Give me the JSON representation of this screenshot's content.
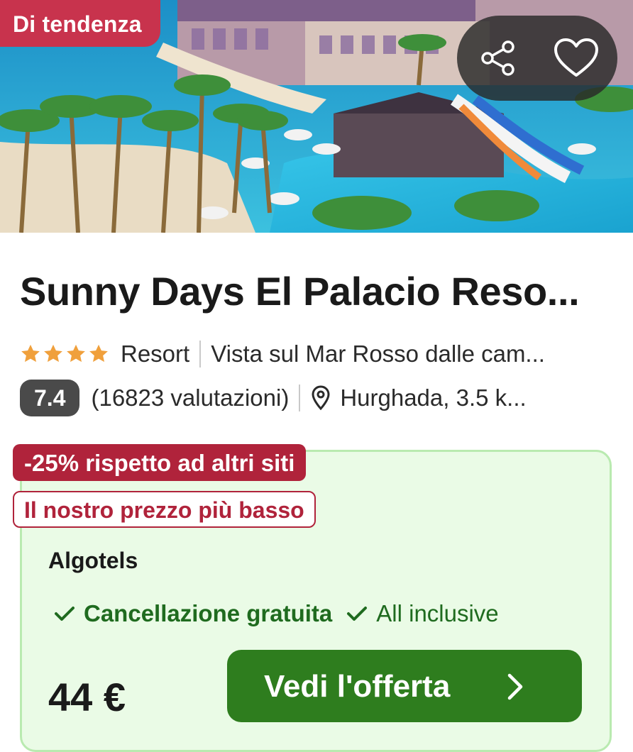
{
  "hero": {
    "badge": "Di tendenza",
    "share_icon": "share-icon",
    "favorite_icon": "heart-icon"
  },
  "hotel": {
    "name": "Sunny Days El Palacio Reso...",
    "star_count": 4,
    "type": "Resort",
    "highlight": "Vista sul Mar Rosso dalle cam...",
    "score": "7.4",
    "reviews": "(16823 valutazioni)",
    "location": "Hurghada, 3.5 k..."
  },
  "offer": {
    "discount": "-25% rispetto ad altri siti",
    "lowest_price": "Il nostro prezzo più basso",
    "provider": "Algotels",
    "features": [
      "Cancellazione gratuita",
      "All inclusive"
    ],
    "price": "44 €",
    "cta_label": "Vedi l'offerta"
  },
  "colors": {
    "badge_red": "#c8334d",
    "discount_red": "#b0233b",
    "offer_bg": "#eafbe6",
    "offer_border": "#b9eab0",
    "feature_green": "#1f6b1f",
    "cta_green": "#2e7d1e",
    "star_orange": "#f0a03c",
    "score_bg": "#4a4a4a"
  }
}
